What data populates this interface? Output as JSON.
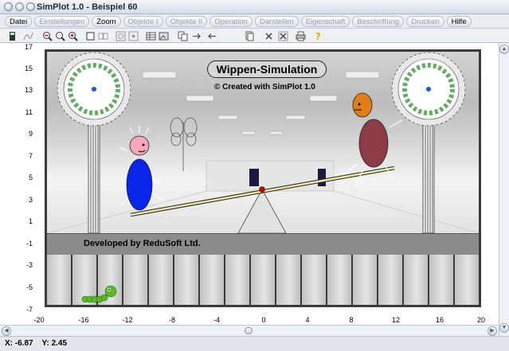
{
  "window": {
    "title": "SimPlot 1.0 - Beispiel 60"
  },
  "menu": [
    {
      "label": "Datei",
      "enabled": true
    },
    {
      "label": "Einstellungen",
      "enabled": false
    },
    {
      "label": "Zoom",
      "enabled": true
    },
    {
      "label": "Objekte I",
      "enabled": false
    },
    {
      "label": "Objekte II",
      "enabled": false
    },
    {
      "label": "Operation",
      "enabled": false
    },
    {
      "label": "Darstellen",
      "enabled": false
    },
    {
      "label": "Eigenschaft",
      "enabled": false
    },
    {
      "label": "Beschriftung",
      "enabled": false
    },
    {
      "label": "Drucken",
      "enabled": false
    },
    {
      "label": "Hilfe",
      "enabled": true
    }
  ],
  "toolbar": [
    {
      "icon": "calculator-icon"
    },
    {
      "icon": "function-icon"
    },
    {
      "icon": "zoom-out-icon"
    },
    {
      "icon": "zoom-icon"
    },
    {
      "icon": "zoom-in-icon"
    },
    {
      "icon": "square-icon"
    },
    {
      "icon": "dual-square-icon"
    },
    {
      "icon": "target-icon"
    },
    {
      "icon": "grid-target-icon"
    },
    {
      "icon": "table-icon"
    },
    {
      "icon": "image-icon"
    },
    {
      "icon": "copy-icon"
    },
    {
      "icon": "arrow-right-icon"
    },
    {
      "icon": "arrow-left-icon"
    },
    {
      "icon": "pages-icon"
    },
    {
      "icon": "cross-icon"
    },
    {
      "icon": "cross-box-icon"
    },
    {
      "icon": "printer-icon"
    },
    {
      "icon": "help-icon"
    }
  ],
  "plot": {
    "yticks": [
      "17",
      "15",
      "13",
      "11",
      "9",
      "7",
      "5",
      "3",
      "1",
      "-1",
      "-3",
      "-5",
      "-7"
    ],
    "xticks": [
      "-20",
      "-16",
      "-12",
      "-8",
      "-4",
      "0",
      "4",
      "8",
      "12",
      "16",
      "20"
    ],
    "title": "Wippen-Simulation",
    "copyright": "© Created with SimPlot 1.0",
    "developer": "Developed by ReduSoft Ltd."
  },
  "status": {
    "x_label": "X:",
    "x_value": "-6.87",
    "y_label": "Y:",
    "y_value": "2.45"
  },
  "colors": {
    "accent": "#1f57c3",
    "frame": "#3b3b3b",
    "band": "#8c8c8c"
  }
}
